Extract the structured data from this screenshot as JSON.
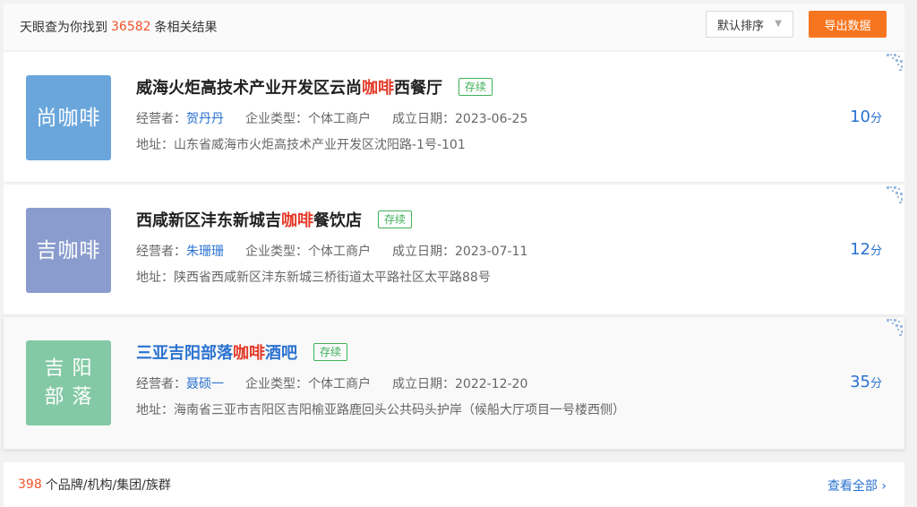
{
  "header": {
    "prefix": "天眼查为你找到",
    "count": "36582",
    "suffix": "条相关结果",
    "sort_label": "默认排序",
    "export_label": "导出数据"
  },
  "results": [
    {
      "logo_lines": [
        "尚咖啡"
      ],
      "logo_color": "#6aa6dc",
      "name_pre": "威海火炬高技术产业开发区云尚",
      "name_kw": "咖啡",
      "name_post": "西餐厅",
      "status": "存续",
      "operator_label": "经营者：",
      "operator": "贺丹丹",
      "type_label": "企业类型：",
      "type": "个体工商户",
      "date_label": "成立日期：",
      "date": "2023-06-25",
      "address_label": "地址：",
      "address": "山东省威海市火炬高技术产业开发区沈阳路-1号-101",
      "score": "10",
      "score_unit": "分"
    },
    {
      "logo_lines": [
        "吉咖啡"
      ],
      "logo_color": "#8a9ccd",
      "name_pre": "西咸新区沣东新城吉",
      "name_kw": "咖啡",
      "name_post": "餐饮店",
      "status": "存续",
      "operator_label": "经营者：",
      "operator": "朱珊珊",
      "type_label": "企业类型：",
      "type": "个体工商户",
      "date_label": "成立日期：",
      "date": "2023-07-11",
      "address_label": "地址：",
      "address": "陕西省西咸新区沣东新城三桥街道太平路社区太平路88号",
      "score": "12",
      "score_unit": "分"
    },
    {
      "logo_lines": [
        "吉 阳",
        "部 落"
      ],
      "logo_color": "#84c9a5",
      "name_pre": "三亚吉阳部落",
      "name_kw": "咖啡",
      "name_post": "酒吧",
      "status": "存续",
      "operator_label": "经营者：",
      "operator": "聂硕一",
      "type_label": "企业类型：",
      "type": "个体工商户",
      "date_label": "成立日期：",
      "date": "2022-12-20",
      "address_label": "地址：",
      "address": "海南省三亚市吉阳区吉阳榆亚路鹿回头公共码头护岸（候船大厅项目一号楼西侧）",
      "score": "35",
      "score_unit": "分"
    }
  ],
  "footer": {
    "count": "398",
    "label": "个品牌/机构/集团/族群",
    "view_all": "查看全部"
  },
  "icons": {
    "caret": "caret-down-icon",
    "qr": "qrcode-icon",
    "chevron": "chevron-right-icon"
  }
}
